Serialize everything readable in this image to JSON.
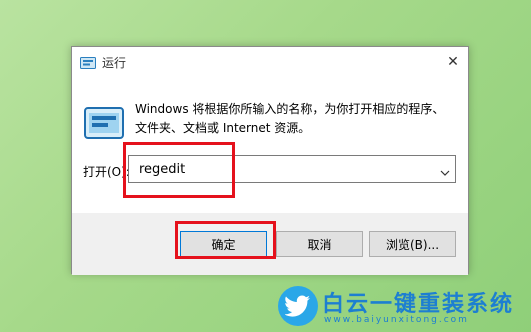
{
  "window": {
    "title": "运行",
    "close_glyph": "✕",
    "description": "Windows 将根据你所输入的名称，为你打开相应的程序、文件夹、文档或 Internet 资源。"
  },
  "form": {
    "open_label": "打开(O):",
    "input_value": "regedit"
  },
  "buttons": {
    "ok": "确定",
    "cancel": "取消",
    "browse": "浏览(B)..."
  },
  "watermark": {
    "title": "白云一键重装系统",
    "url": "www.baiyunxitong.com"
  },
  "colors": {
    "highlight": "#e5111c",
    "accent": "#0078d7",
    "brand": "#1d7fd1"
  },
  "icons": [
    "run-app-icon",
    "close-icon",
    "chevron-down-icon",
    "twitter-bird-icon"
  ]
}
